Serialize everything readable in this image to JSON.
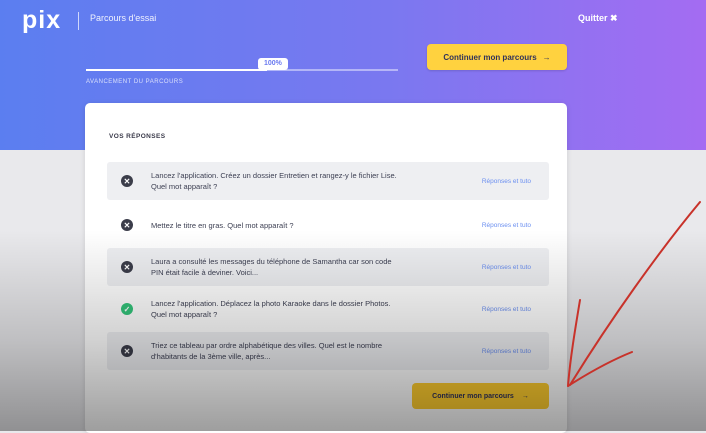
{
  "header": {
    "logo": "pix",
    "title": "Parcours d'essai",
    "quit_label": "Quitter ✖"
  },
  "progress": {
    "badge": "100%",
    "fraction": 0.58,
    "label": "Avancement du parcours"
  },
  "actions": {
    "continue_top_label": "Continuer mon parcours",
    "continue_bottom_label": "Continuer mon parcours"
  },
  "answers": {
    "title": "VOS RÉPONSES",
    "link_label": "Réponses et tuto",
    "items": [
      {
        "status": "wrong",
        "text": "Lancez l'application. Créez un dossier Entretien et rangez-y le fichier Lise. Quel mot apparaît ?"
      },
      {
        "status": "wrong",
        "text": "Mettez le titre en gras. Quel mot apparaît ?"
      },
      {
        "status": "wrong",
        "text": "Laura a consulté les messages du téléphone de Samantha car son code PIN était facile à deviner. Voici..."
      },
      {
        "status": "right",
        "text": "Lancez l'application. Déplacez la photo Karaoke dans le dossier Photos. Quel mot apparaît ?"
      },
      {
        "status": "wrong",
        "text": "Triez ce tableau par ordre alphabétique des villes. Quel est le nombre d'habitants de la 3ème ville, après..."
      }
    ]
  },
  "colors": {
    "accent": "#ffd23f",
    "gradient_start": "#5b7ef0",
    "gradient_end": "#a46cf2",
    "annotation": "#c8322a"
  }
}
